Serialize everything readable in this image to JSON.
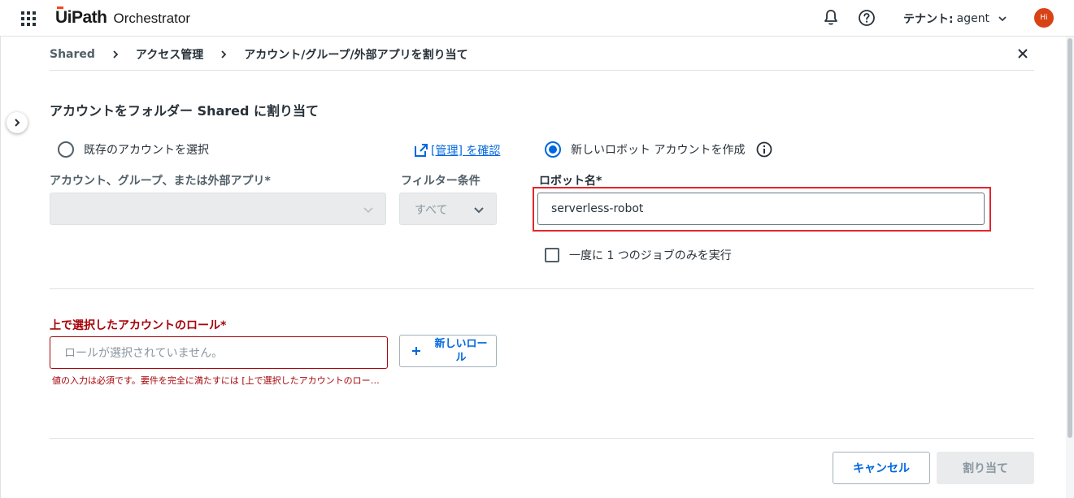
{
  "header": {
    "brand": "UiPath",
    "product": "Orchestrator",
    "tenant_label": "テナント:",
    "tenant_value": "agent",
    "avatar_initials": "Hi"
  },
  "breadcrumb": [
    "Shared",
    "アクセス管理",
    "アカウント/グループ/外部アプリを割り当て"
  ],
  "form": {
    "title": "アカウントをフォルダー Shared に割り当て",
    "option_existing": "既存のアカウントを選択",
    "manage_link": "[管理] を確認",
    "option_new": "新しいロボット アカウントを作成",
    "account_label": "アカウント、グループ、または外部アプリ*",
    "filter_label": "フィルター条件",
    "filter_value": "すべて",
    "robot_name_label": "ロボット名*",
    "robot_name_value": "serverless-robot",
    "single_job_label": "一度に 1 つのジョブのみを実行",
    "roles_label": "上で選択したアカウントのロール*",
    "roles_placeholder": "ロールが選択されていません。",
    "roles_error": "値の入力は必須です。要件を完全に満たすには [上で選択したアカウントのロール] を選択してください。",
    "new_role_button": "新しいロール"
  },
  "footer": {
    "cancel": "キャンセル",
    "assign": "割り当て"
  },
  "colors": {
    "accent": "#0067df",
    "error": "#a6040a",
    "highlight": "#e3262d",
    "brand_orange": "#fa4616"
  }
}
